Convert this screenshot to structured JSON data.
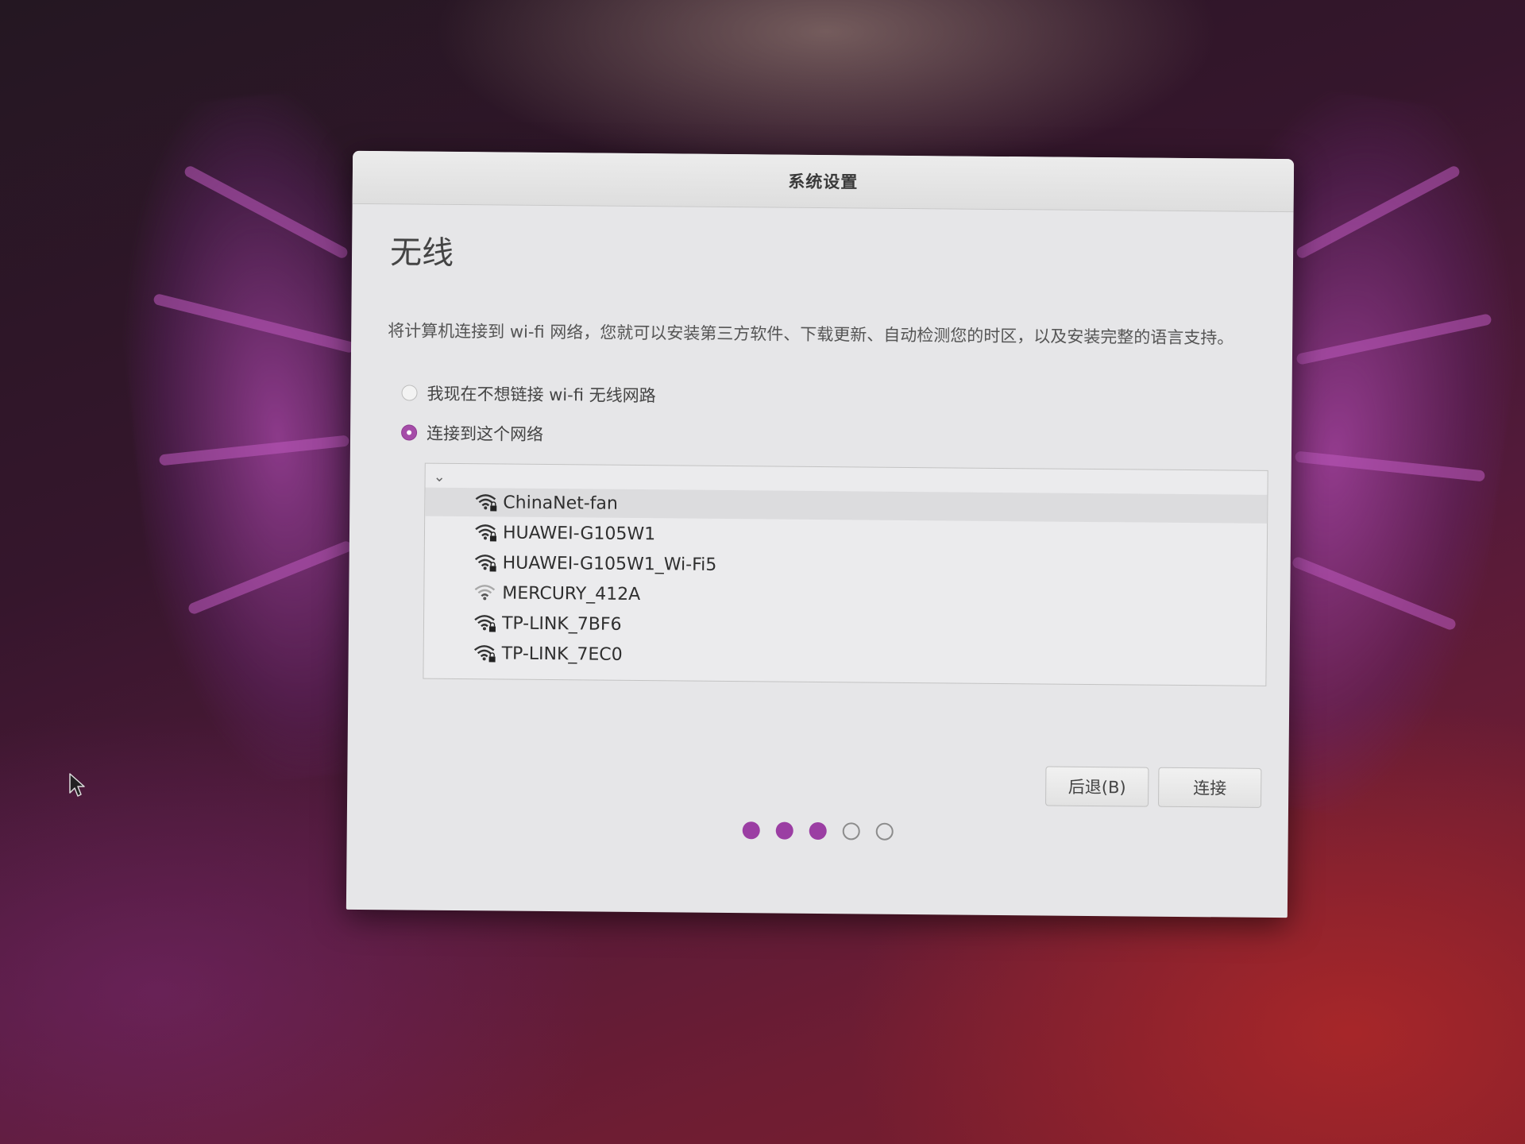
{
  "window": {
    "title": "系统设置"
  },
  "page": {
    "heading": "无线",
    "description": "将计算机连接到 wi-fi 网络，您就可以安装第三方软件、下载更新、自动检测您的时区，以及安装完整的语言支持。"
  },
  "options": {
    "skip_label": "我现在不想链接 wi-fi 无线网路",
    "connect_label": "连接到这个网络",
    "selected": "connect"
  },
  "networks": [
    {
      "ssid": "ChinaNet-fan",
      "signal": "strong",
      "secured": true,
      "selected": true
    },
    {
      "ssid": "HUAWEI-G105W1",
      "signal": "strong",
      "secured": true,
      "selected": false
    },
    {
      "ssid": "HUAWEI-G105W1_Wi-Fi5",
      "signal": "strong",
      "secured": true,
      "selected": false
    },
    {
      "ssid": "MERCURY_412A",
      "signal": "weak",
      "secured": false,
      "selected": false
    },
    {
      "ssid": "TP-LINK_7BF6",
      "signal": "strong",
      "secured": true,
      "selected": false
    },
    {
      "ssid": "TP-LINK_7EC0",
      "signal": "strong",
      "secured": true,
      "selected": false
    }
  ],
  "buttons": {
    "back_label": "后退(B)",
    "connect_label": "连接"
  },
  "progress": {
    "current_step": 3,
    "total_steps": 5
  },
  "colors": {
    "accent": "#9b3ea3",
    "window_bg": "#e6e6e8"
  },
  "icons": {
    "list_toggle": "chevron-down-icon",
    "network": "wifi-signal-icon",
    "lock": "lock-icon",
    "cursor": "mouse-pointer-icon"
  }
}
